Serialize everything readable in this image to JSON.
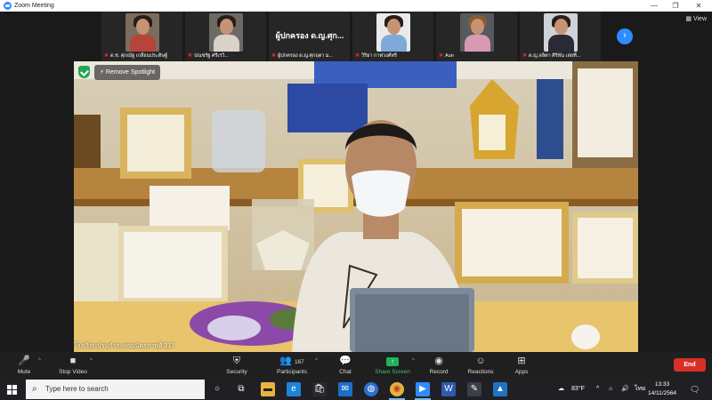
{
  "window": {
    "title": "Zoom Meeting",
    "controls": [
      "—",
      "❐",
      "✕"
    ]
  },
  "gallery": {
    "tiles": [
      {
        "name": "ด.ช. ศุภณัฐ  เกลื่อนประดิษฐ์",
        "muted": true,
        "type": "video",
        "shirt": "#b8433a",
        "bg": "#7a6d5f"
      },
      {
        "name": "ปณชรัฐ  ศรีเรวิ...",
        "muted": true,
        "type": "video",
        "shirt": "#d8d2c8",
        "bg": "#6d6a64"
      },
      {
        "name": "ผู้ปกครอง ด.ญ.ศุกฤตา  ม...",
        "muted": true,
        "type": "text",
        "big": "ผู้ปกครอง ด.ญ.ศุก..."
      },
      {
        "name": "วิริยา  กาฬวงศ์ทรี",
        "muted": true,
        "type": "video",
        "shirt": "#7ea9d8",
        "bg": "#eaeaea"
      },
      {
        "name": "Aun",
        "muted": true,
        "type": "video",
        "shirt": "#d89ab0",
        "bg": "#555a5e"
      },
      {
        "name": "ด.ญ.ลลิตา  ศิริพัน  เล่ยที่...",
        "muted": true,
        "type": "video",
        "shirt": "#2a2a35",
        "bg": "#cfd3d8"
      }
    ],
    "view_label": "View",
    "next_arrow": "›"
  },
  "spotlight": {
    "label": "Remove Spotlight",
    "caption": "โรงเรียนบ้านกำสะหวนนิตรภาพที่ 217"
  },
  "toolbar": {
    "mute": "Mute",
    "stop_video": "Stop Video",
    "security": "Security",
    "participants": "Participants",
    "participants_count": "167",
    "chat": "Chat",
    "share_screen": "Share Screen",
    "record": "Record",
    "reactions": "Reactions",
    "apps": "Apps",
    "end": "End"
  },
  "taskbar": {
    "search_placeholder": "Type here to search",
    "weather": "83°F",
    "language": "ไทย",
    "time": "13:33",
    "date": "14/11/2564"
  },
  "colors": {
    "accent": "#2d8cff",
    "end": "#d93025",
    "share": "#1fb257",
    "mic_muted": "#e02828"
  }
}
